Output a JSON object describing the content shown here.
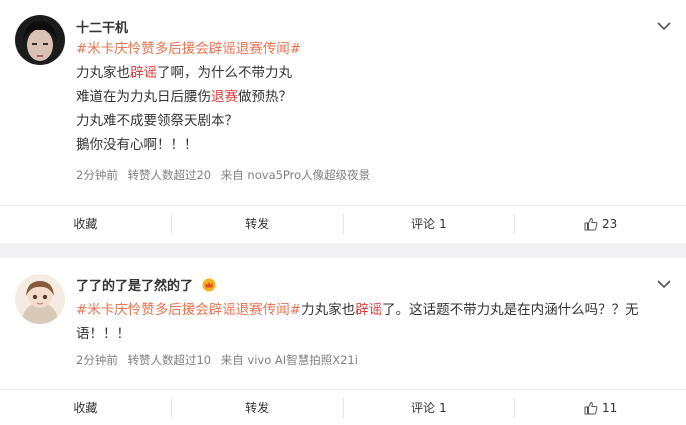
{
  "posts": [
    {
      "username": "十二干机",
      "content_lines": [
        [
          {
            "t": "#米卡庆怜赞多后援会辟谣退赛传闻#",
            "c": "topic"
          }
        ],
        [
          {
            "t": "力丸家也",
            "c": ""
          },
          {
            "t": "辟谣",
            "c": "red"
          },
          {
            "t": "了啊，为什么不带力丸",
            "c": ""
          }
        ],
        [
          {
            "t": "难道在为力丸日后腰伤",
            "c": ""
          },
          {
            "t": "退赛",
            "c": "red"
          },
          {
            "t": "做预热？",
            "c": ""
          }
        ],
        [
          {
            "t": "力丸难不成要领祭天剧本？",
            "c": ""
          }
        ],
        [
          {
            "t": "鵝你没有心啊！！！",
            "c": ""
          }
        ]
      ],
      "time": "2分钟前",
      "reposts_info": "转赞人数超过20",
      "source": "来自 nova5Pro人像超级夜景",
      "actions": {
        "collect": "收藏",
        "repost": "转发",
        "comment": "评论",
        "comment_count": "1",
        "like_count": "23"
      }
    },
    {
      "username": "了了的了是了然的了",
      "content_lines": [
        [
          {
            "t": "#米卡庆怜赞多后援会辟谣退赛传闻#",
            "c": "topic"
          },
          {
            "t": "力丸家也",
            "c": ""
          },
          {
            "t": "辟谣",
            "c": "red"
          },
          {
            "t": "了。这话题不带力丸是在内涵什么吗？？无",
            "c": ""
          }
        ],
        [
          {
            "t": "语！！！",
            "c": ""
          }
        ]
      ],
      "time": "2分钟前",
      "reposts_info": "转赞人数超过10",
      "source": "来自 vivo AI智慧拍照X21i",
      "actions": {
        "collect": "收藏",
        "repost": "转发",
        "comment": "评论",
        "comment_count": "1",
        "like_count": "11"
      }
    }
  ],
  "icons": {
    "more": "chevron-down-icon",
    "like": "thumbs-up-icon",
    "badge": "crown-icon"
  },
  "colors": {
    "topic": "#eb7350",
    "highlight": "#e03c3c",
    "meta": "#808080",
    "background": "#f2f2f5"
  }
}
